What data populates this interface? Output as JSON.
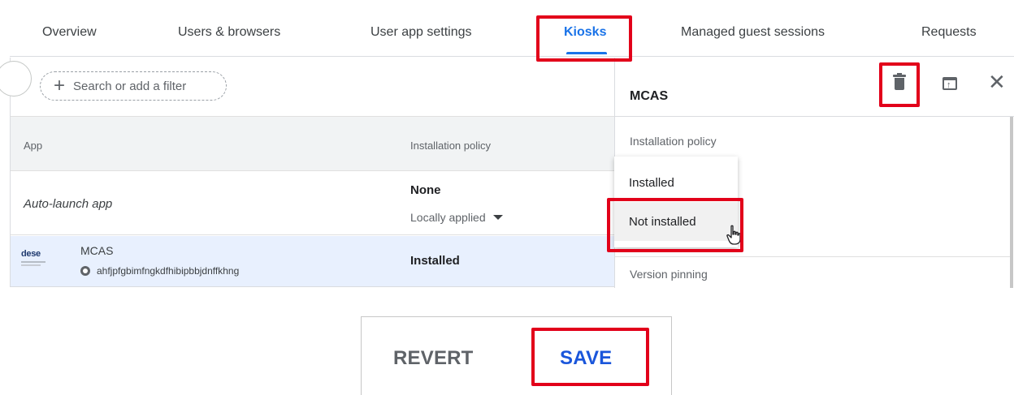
{
  "tabs": [
    {
      "label": "Overview"
    },
    {
      "label": "Users & browsers"
    },
    {
      "label": "User app settings"
    },
    {
      "label": "Kiosks"
    },
    {
      "label": "Managed guest sessions"
    },
    {
      "label": "Requests"
    }
  ],
  "filter": {
    "label": "Search or add a filter"
  },
  "table": {
    "headers": {
      "app": "App",
      "policy": "Installation policy"
    },
    "auto_launch": {
      "label": "Auto-launch app",
      "value": "None",
      "applied": "Locally applied"
    },
    "app_row": {
      "logo_text": "dese",
      "name": "MCAS",
      "id": "ahfjpfgbimfngkdfhibipbbjdnffkhng",
      "policy": "Installed"
    }
  },
  "panel": {
    "title": "MCAS",
    "section_label": "Installation policy",
    "next_section": "Version pinning"
  },
  "menu": {
    "items": [
      {
        "label": "Installed"
      },
      {
        "label": "Not installed"
      }
    ]
  },
  "actions": {
    "revert": "REVERT",
    "save": "SAVE"
  },
  "colors": {
    "highlight": "#e2001a",
    "accent": "#1a73e8",
    "save": "#1a56db",
    "row_selected": "#e8f0fe"
  },
  "icons": [
    "plus-icon",
    "caret-down-icon",
    "chrome-icon",
    "trash-icon",
    "open-in-new-icon",
    "close-icon",
    "hand-cursor-icon"
  ]
}
